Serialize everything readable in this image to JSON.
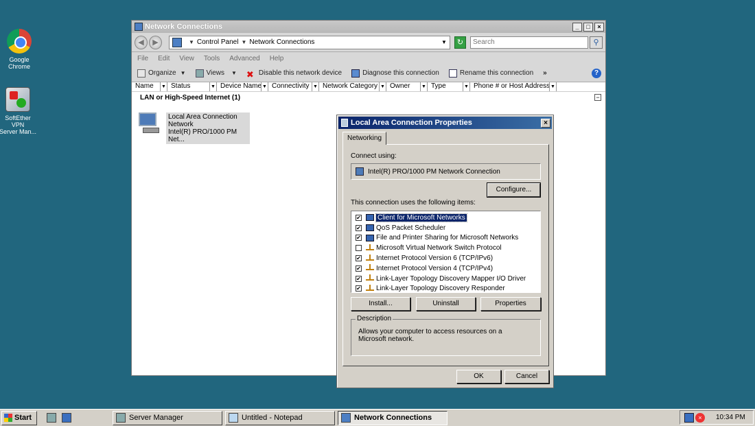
{
  "desktop": {
    "icons": [
      {
        "label_line1": "Google",
        "label_line2": "Chrome"
      },
      {
        "label_line1": "SoftEther VPN",
        "label_line2": "Server Man..."
      }
    ]
  },
  "window": {
    "title": "Network Connections",
    "controls": {
      "minimize": "_",
      "maximize": "□",
      "close": "×"
    },
    "address": {
      "crumbs": [
        "Control Panel",
        "Network Connections"
      ]
    },
    "search": {
      "placeholder": "Search"
    },
    "menu": [
      "File",
      "Edit",
      "View",
      "Tools",
      "Advanced",
      "Help"
    ],
    "toolbar": {
      "organize": "Organize",
      "views": "Views",
      "disable": "Disable this network device",
      "diagnose": "Diagnose this connection",
      "rename": "Rename this connection",
      "more": "»"
    },
    "columns": [
      "Name",
      "Status",
      "Device Name",
      "Connectivity",
      "Network Category",
      "Owner",
      "Type",
      "Phone # or Host Address"
    ],
    "group": {
      "title": "LAN or High-Speed Internet (1)",
      "collapse": "−"
    },
    "connection": {
      "name": "Local Area Connection",
      "status": "Network",
      "device": "Intel(R) PRO/1000 PM Net..."
    }
  },
  "dialog": {
    "title": "Local Area Connection Properties",
    "close": "×",
    "tab": "Networking",
    "connect_using_label": "Connect using:",
    "adapter": "Intel(R) PRO/1000 PM Network Connection",
    "configure": "Configure...",
    "items_label": "This connection uses the following items:",
    "items": [
      {
        "checked": true,
        "icon": "network-client-icon",
        "label": "Client for Microsoft Networks",
        "selected": true
      },
      {
        "checked": true,
        "icon": "network-service-icon",
        "label": "QoS Packet Scheduler",
        "selected": false
      },
      {
        "checked": true,
        "icon": "network-service-icon",
        "label": "File and Printer Sharing for Microsoft Networks",
        "selected": false
      },
      {
        "checked": false,
        "icon": "protocol-icon",
        "label": "Microsoft Virtual Network Switch Protocol",
        "selected": false
      },
      {
        "checked": true,
        "icon": "protocol-icon",
        "label": "Internet Protocol Version 6 (TCP/IPv6)",
        "selected": false
      },
      {
        "checked": true,
        "icon": "protocol-icon",
        "label": "Internet Protocol Version 4 (TCP/IPv4)",
        "selected": false
      },
      {
        "checked": true,
        "icon": "protocol-icon",
        "label": "Link-Layer Topology Discovery Mapper I/O Driver",
        "selected": false
      },
      {
        "checked": true,
        "icon": "protocol-icon",
        "label": "Link-Layer Topology Discovery Responder",
        "selected": false
      }
    ],
    "install": "Install...",
    "uninstall": "Uninstall",
    "properties": "Properties",
    "description_legend": "Description",
    "description": "Allows your computer to access resources on a Microsoft network.",
    "ok": "OK",
    "cancel": "Cancel"
  },
  "taskbar": {
    "start": "Start",
    "tasks": [
      {
        "label": "Server Manager",
        "active": false
      },
      {
        "label": "Untitled - Notepad",
        "active": false
      },
      {
        "label": "Network Connections",
        "active": true
      }
    ],
    "clock": "10:34 PM"
  }
}
